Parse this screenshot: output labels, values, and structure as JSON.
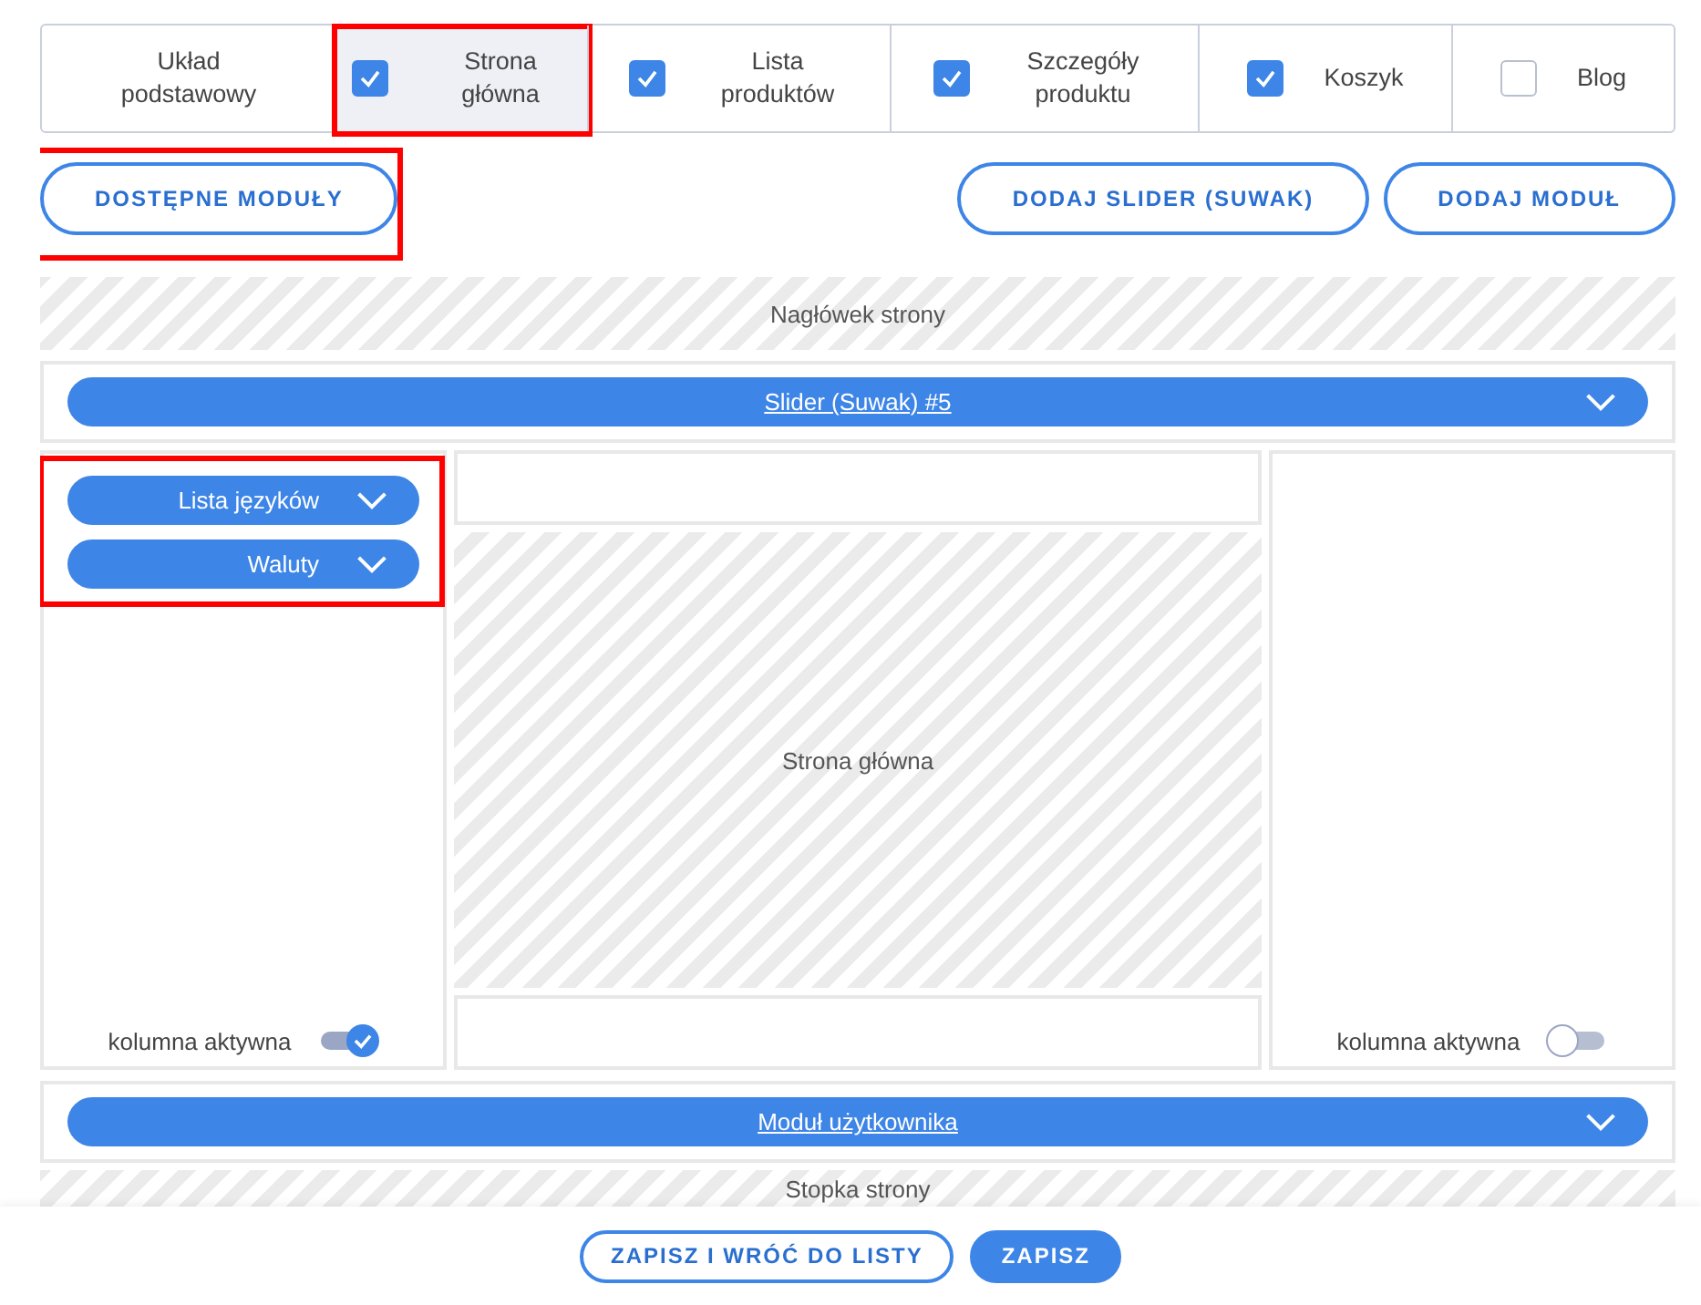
{
  "tabs": [
    {
      "label": "Układ podstawowy",
      "kind": "plain",
      "selected": false
    },
    {
      "label": "Strona główna",
      "kind": "check",
      "checked": true,
      "selected": true,
      "highlighted": true
    },
    {
      "label": "Lista produktów",
      "kind": "check",
      "checked": true,
      "selected": false
    },
    {
      "label": "Szczegóły produktu",
      "kind": "check",
      "checked": true,
      "selected": false
    },
    {
      "label": "Koszyk",
      "kind": "check",
      "checked": true,
      "selected": false
    },
    {
      "label": "Blog",
      "kind": "check",
      "checked": false,
      "selected": false
    }
  ],
  "toolbar": {
    "left_buttons": [
      {
        "label": "DOSTĘPNE MODUŁY",
        "highlighted": true
      }
    ],
    "right_buttons": [
      {
        "label": "DODAJ SLIDER (SUWAK)"
      },
      {
        "label": "DODAJ MODUŁ"
      }
    ]
  },
  "header_zone": {
    "label": "Nagłówek strony"
  },
  "slider_bar": {
    "label": "Slider (Suwak) #5"
  },
  "columns": {
    "left": {
      "highlighted": true,
      "modules": [
        {
          "label": "Lista języków"
        },
        {
          "label": "Waluty"
        }
      ],
      "active_label": "kolumna aktywna",
      "active": true
    },
    "center": {
      "label": "Strona główna"
    },
    "right": {
      "active_label": "kolumna aktywna",
      "active": false
    }
  },
  "module_bar": {
    "label": "Moduł użytkownika"
  },
  "footer_zone": {
    "label": "Stopka strony"
  },
  "actions": [
    {
      "label": "ZAPISZ I WRÓĆ DO LISTY",
      "kind": "outline"
    },
    {
      "label": "ZAPISZ",
      "kind": "filled"
    }
  ]
}
